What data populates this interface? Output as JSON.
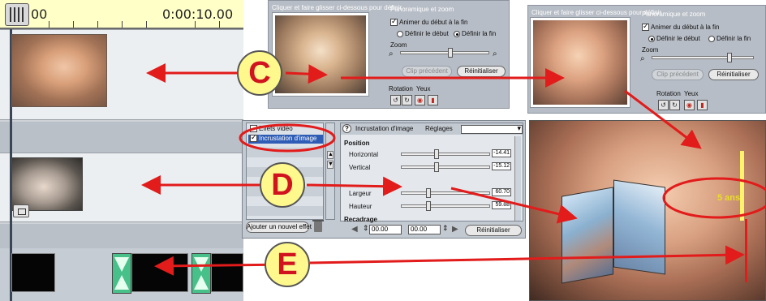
{
  "timeline": {
    "time_start": "00",
    "time_end": "0:00:10.00"
  },
  "panzoom": {
    "instruction": "Cliquer et faire glisser ci-dessous pour définir",
    "group_title": "Panoramique et zoom",
    "animate_label": "Animer du début à la fin",
    "define_start": "Définir le début",
    "define_end": "Définir la fin",
    "zoom_label": "Zoom",
    "prev_clip": "Clip précédent",
    "reset": "Réinitialiser",
    "rotation_label": "Rotation",
    "eyes_label": "Yeux"
  },
  "effects": {
    "list_header": "Effets vidéo",
    "list_selected": "Incrustation d'image",
    "add_button": "Ajouter un nouvel effet",
    "props_title": "Incrustation d'image",
    "settings_label": "Réglages",
    "section_position": "Position",
    "horizontal_label": "Horizontal",
    "horizontal_value": "-14.41",
    "vertical_label": "Vertical",
    "vertical_value": "-15.12",
    "width_label": "Largeur",
    "width_value": "60.70",
    "height_label": "Hauteur",
    "height_value": "59.88",
    "section_crop": "Recadrage",
    "time_start": "00.00",
    "time_end": "00.00",
    "reset": "Réinitialiser"
  },
  "overlay_text": "5 ans",
  "callouts": {
    "c": "C",
    "d": "D",
    "e": "E"
  },
  "colors": {
    "arrow": "#e21b1b",
    "callout_fill": "#fff88c",
    "highlight": "#2f5db6"
  }
}
